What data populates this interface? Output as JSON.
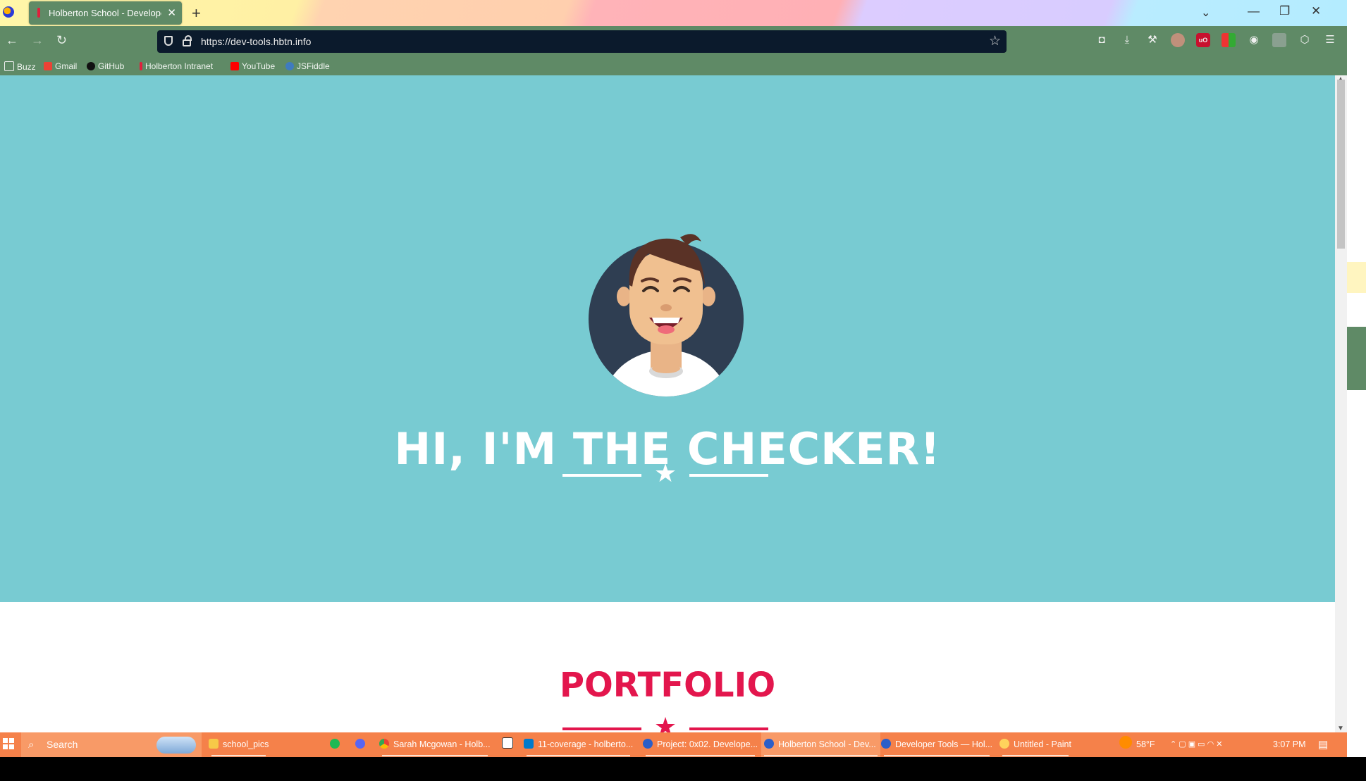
{
  "browser": {
    "tab": {
      "title": "Holberton School - Developer t",
      "close": "✕"
    },
    "new_tab": "+",
    "tab_list": "⌄",
    "window_controls": {
      "minimize": "—",
      "restore": "❐",
      "close": "✕"
    },
    "nav": {
      "back": "←",
      "forward": "→",
      "reload": "↻"
    },
    "url": "https://dev-tools.hbtn.info",
    "bookmark_star": "☆",
    "toolbar_icons": [
      "pocket-icon",
      "download-icon",
      "wrench-icon",
      "profile-avatar-icon",
      "ublock-icon",
      "extension-icon",
      "eye-extension-icon",
      "extension-icon-2",
      "extensions-puzzle-icon",
      "menu-icon"
    ],
    "bookmarks": [
      {
        "label": "Buzz",
        "icon": "folder-icon"
      },
      {
        "label": "Gmail",
        "icon": "gmail-icon"
      },
      {
        "label": "GitHub",
        "icon": "github-icon"
      },
      {
        "label": "Holberton Intranet",
        "icon": "holberton-icon"
      },
      {
        "label": "YouTube",
        "icon": "youtube-icon"
      },
      {
        "label": "JSFiddle",
        "icon": "jsfiddle-icon"
      }
    ]
  },
  "page": {
    "hero_title": "HI, I'M THE CHECKER!",
    "portfolio_title": "PORTFOLIO",
    "divider_star": "★",
    "colors": {
      "hero_bg": "#78cbd2",
      "accent": "#e3164d",
      "browser_chrome": "#5f8a66"
    }
  },
  "taskbar": {
    "start": "start-icon",
    "search": "Search",
    "items": [
      {
        "label": "school_pics",
        "icon": "folder-icon"
      },
      {
        "label": "",
        "icon": "spotify-icon"
      },
      {
        "label": "",
        "icon": "discord-icon"
      },
      {
        "label": "Sarah Mcgowan - Holb...",
        "icon": "chrome-icon"
      },
      {
        "label": "",
        "icon": "notion-icon"
      },
      {
        "label": "11-coverage - holberto...",
        "icon": "vscode-icon"
      },
      {
        "label": "Project: 0x02. Develope...",
        "icon": "firefox-icon"
      },
      {
        "label": "Holberton School - Dev...",
        "icon": "firefox-icon"
      },
      {
        "label": "Developer Tools — Hol...",
        "icon": "firefox-icon"
      },
      {
        "label": "Untitled - Paint",
        "icon": "paint-icon"
      }
    ],
    "weather": "58°F",
    "time": "3:07 PM"
  }
}
